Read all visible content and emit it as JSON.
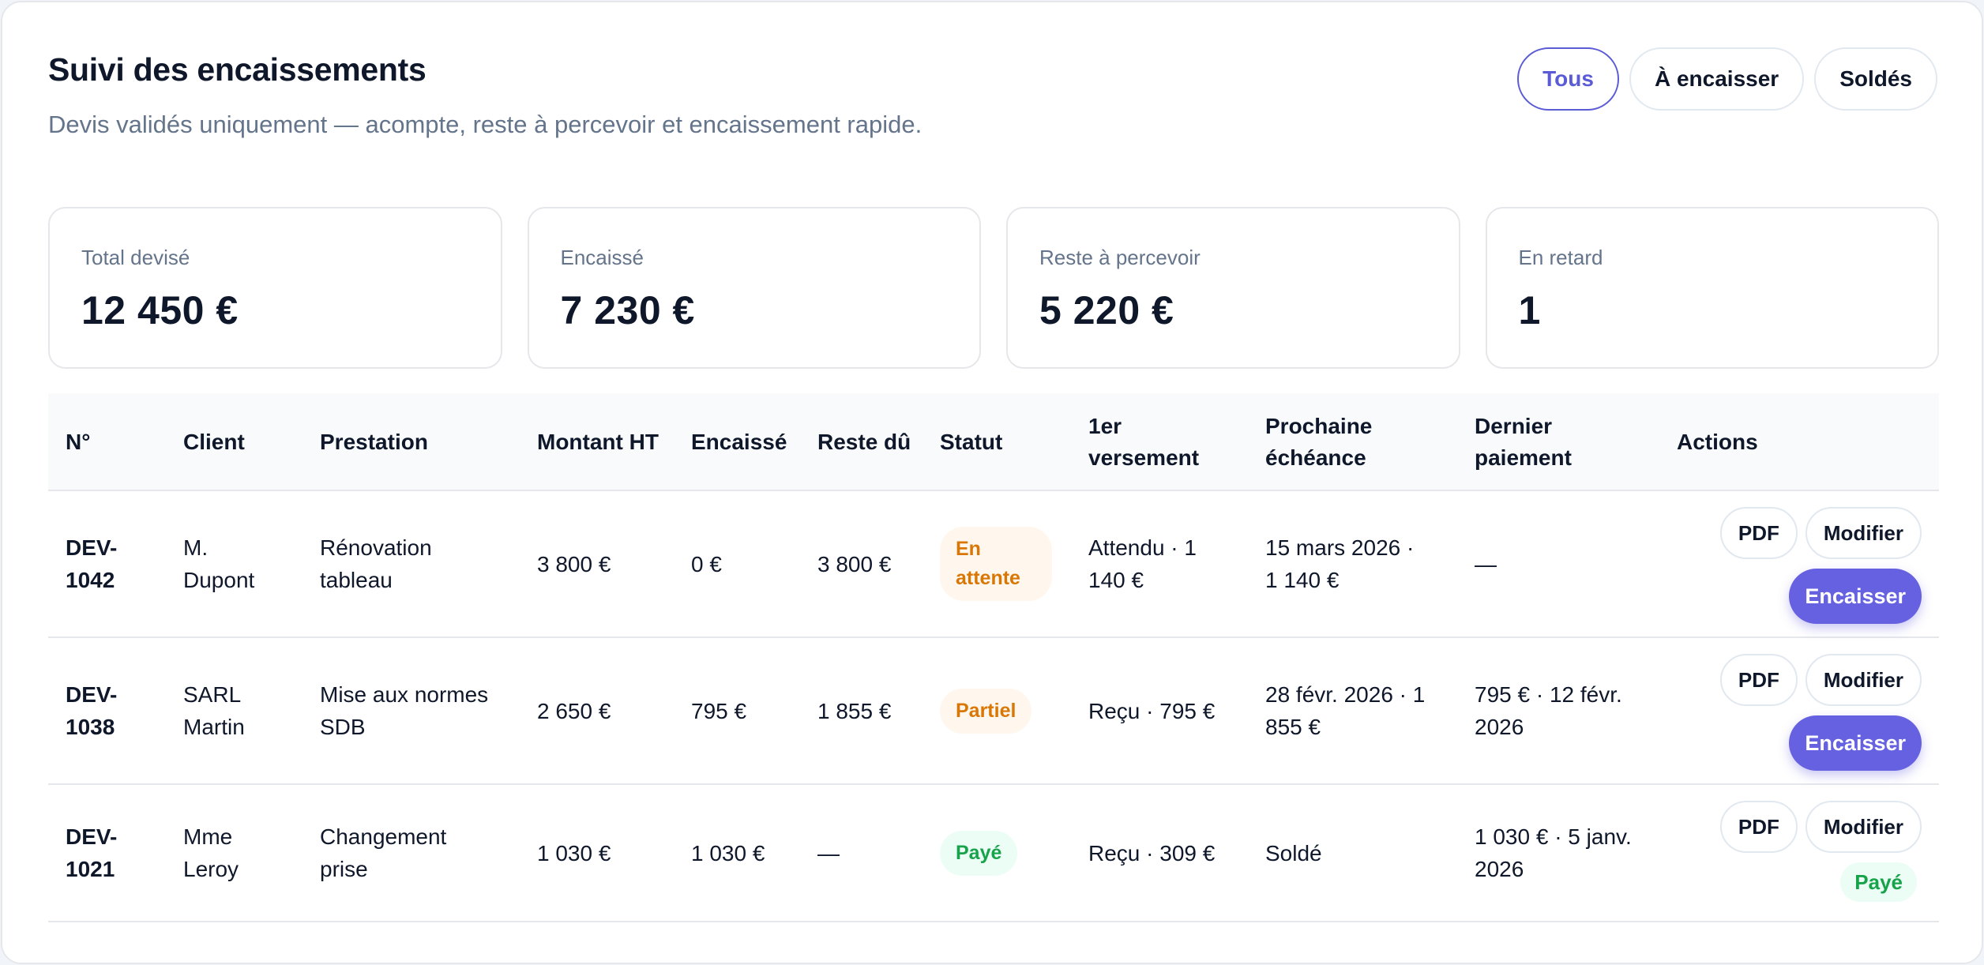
{
  "header": {
    "title": "Suivi des encaissements",
    "subtitle": "Devis validés uniquement — acompte, reste à percevoir et encaissement rapide."
  },
  "filters": [
    {
      "label": "Tous",
      "active": true
    },
    {
      "label": "À encaisser",
      "active": false
    },
    {
      "label": "Soldés",
      "active": false
    }
  ],
  "stats": [
    {
      "label": "Total devisé",
      "value": "12 450 €"
    },
    {
      "label": "Encaissé",
      "value": "7 230 €"
    },
    {
      "label": "Reste à percevoir",
      "value": "5 220 €"
    },
    {
      "label": "En retard",
      "value": "1"
    }
  ],
  "table": {
    "columns": {
      "no": "N°",
      "client": "Client",
      "prestation": "Prestation",
      "montant": "Montant HT",
      "encaisse": "Encaissé",
      "reste": "Reste dû",
      "statut": "Statut",
      "versement": "1er versement",
      "echeance": "Prochaine échéance",
      "dernier": "Dernier paiement",
      "actions": "Actions"
    },
    "rows": [
      {
        "no": "DEV-1042",
        "client": "M. Dupont",
        "prestation": "Rénovation tableau",
        "montant": "3 800 €",
        "encaisse": "0 €",
        "reste": "3 800 €",
        "statut": "En attente",
        "versement": "Attendu · 1 140 €",
        "echeance": "15 mars 2026 · 1 140 €",
        "dernier": "—",
        "pdf": "PDF",
        "modifier": "Modifier",
        "action": "Encaisser"
      },
      {
        "no": "DEV-1038",
        "client": "SARL Martin",
        "prestation": "Mise aux normes SDB",
        "montant": "2 650 €",
        "encaisse": "795 €",
        "reste": "1 855 €",
        "statut": "Partiel",
        "versement": "Reçu · 795 €",
        "echeance": "28 févr. 2026 · 1 855 €",
        "dernier": "795 € · 12 févr. 2026",
        "pdf": "PDF",
        "modifier": "Modifier",
        "action": "Encaisser"
      },
      {
        "no": "DEV-1021",
        "client": "Mme Leroy",
        "prestation": "Changement prise",
        "montant": "1 030 €",
        "encaisse": "1 030 €",
        "reste": "—",
        "statut": "Payé",
        "versement": "Reçu · 309 €",
        "echeance": "Soldé",
        "dernier": "1 030 € · 5 janv. 2026",
        "pdf": "PDF",
        "modifier": "Modifier",
        "action": "Payé"
      }
    ]
  }
}
